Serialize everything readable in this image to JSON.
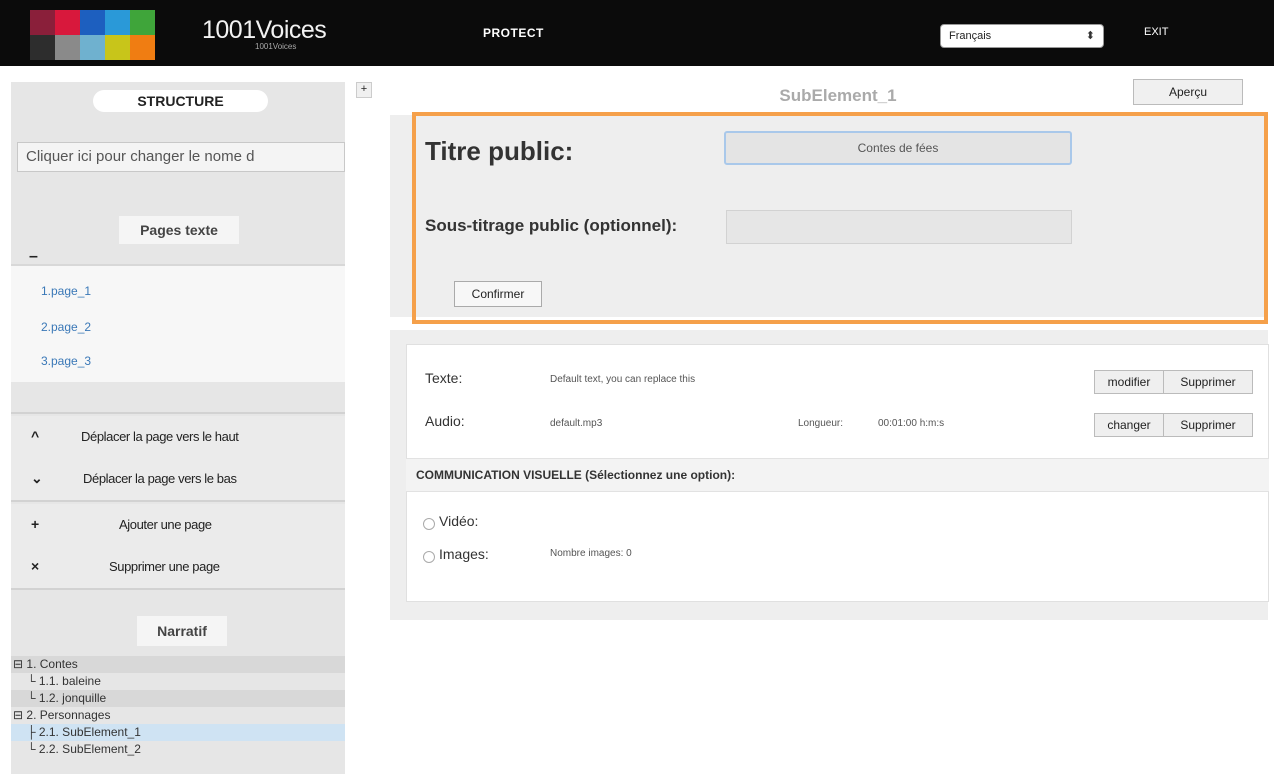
{
  "topbar": {
    "logo_text": "1001Voices",
    "logo_subtext": "1001Voices",
    "logo_colors": [
      "#8a1f3a",
      "#d8183c",
      "#1d5fbf",
      "#2a99d8",
      "#3fa53a",
      "#2d2d2d",
      "#8a8a8a",
      "#6fb1cf",
      "#c8c51a",
      "#f07d12"
    ],
    "protect_label": "PROTECT",
    "language_value": "Français",
    "language_arrows": "⬍",
    "exit_label": "EXIT"
  },
  "sidebar": {
    "structure_label": "STRUCTURE",
    "name_field_text": "Cliquer ici pour changer le nome d",
    "pages_label": "Pages texte",
    "collapse_symbol": "–",
    "pages": [
      "1.page_1",
      "2.page_2",
      "3.page_3"
    ],
    "actions": [
      {
        "icon": "^",
        "icon_name": "chevron-up-icon",
        "label": "Déplacer la page vers le haut"
      },
      {
        "icon": "⌄",
        "icon_name": "chevron-down-icon",
        "label": "Déplacer la page vers le bas"
      },
      {
        "icon": "+",
        "icon_name": "plus-icon",
        "label": "Ajouter une page"
      },
      {
        "icon": "×",
        "icon_name": "close-icon",
        "label": "Supprimer une page"
      }
    ],
    "narratif_label": "Narratif",
    "tree": [
      {
        "text": "⊟ 1. Contes"
      },
      {
        "text": "└ 1.1. baleine"
      },
      {
        "text": "└ 1.2. jonquille"
      },
      {
        "text": "⊟ 2. Personnages"
      },
      {
        "text": "├ 2.1. SubElement_1"
      },
      {
        "text": "└ 2.2. SubElement_2"
      }
    ],
    "toggle_symbol": "+"
  },
  "main": {
    "title": "SubElement_1",
    "apercu_label": "Aperçu",
    "titre_label": "Titre public:",
    "titre_value": "Contes de fées",
    "sous_label": "Sous-titrage public (optionnel):",
    "sous_value": "",
    "confirm_label": "Confirmer"
  },
  "detail": {
    "texte_label": "Texte:",
    "texte_value": "Default text, you can replace this",
    "modifier_label": "modifier",
    "supprimer_label": "Supprimer",
    "audio_label": "Audio:",
    "audio_value": "default.mp3",
    "longueur_label": "Longueur:",
    "longueur_value": "00:01:00 h:m:s",
    "changer_label": "changer",
    "supprimer2_label": "Supprimer",
    "comm_label": "COMMUNICATION VISUELLE (Sélectionnez une option):",
    "video_label": "Vidéo:",
    "images_label": "Images:",
    "nombre_images": "Nombre images: 0"
  },
  "colors": {
    "accent_orange": "#f5a04a",
    "link_blue": "#3a78b7",
    "topbar_bg": "#0b0b0b"
  }
}
